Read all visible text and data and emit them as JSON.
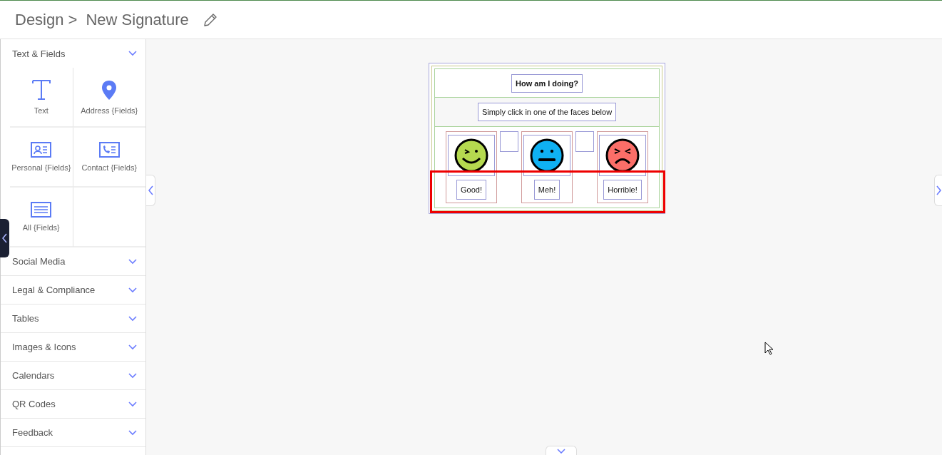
{
  "header": {
    "breadcrumb": "Design >",
    "title": "New Signature"
  },
  "sidebar": {
    "sections": [
      {
        "label": "Text & Fields",
        "expanded": true,
        "tiles": [
          {
            "kind": "text",
            "label": "Text"
          },
          {
            "kind": "pin",
            "label": "Address {Fields}"
          },
          {
            "kind": "personal",
            "label": "Personal {Fields}"
          },
          {
            "kind": "contact",
            "label": "Contact {Fields}"
          },
          {
            "kind": "all",
            "label": "All {Fields}"
          }
        ]
      },
      {
        "label": "Social Media",
        "expanded": false
      },
      {
        "label": "Legal & Compliance",
        "expanded": false
      },
      {
        "label": "Tables",
        "expanded": false
      },
      {
        "label": "Images & Icons",
        "expanded": false
      },
      {
        "label": "Calendars",
        "expanded": false
      },
      {
        "label": "QR Codes",
        "expanded": false
      },
      {
        "label": "Feedback",
        "expanded": false
      }
    ]
  },
  "signature": {
    "title": "How am I doing?",
    "subtitle": "Simply click in one of the faces below",
    "labels_selected": true,
    "faces": [
      {
        "kind": "wink",
        "color": "#b5d94f",
        "label": "Good!"
      },
      {
        "kind": "neutral",
        "color": "#0fb1f2",
        "label": "Meh!"
      },
      {
        "kind": "sad",
        "color": "#fb6e68",
        "label": "Horrible!"
      }
    ]
  }
}
